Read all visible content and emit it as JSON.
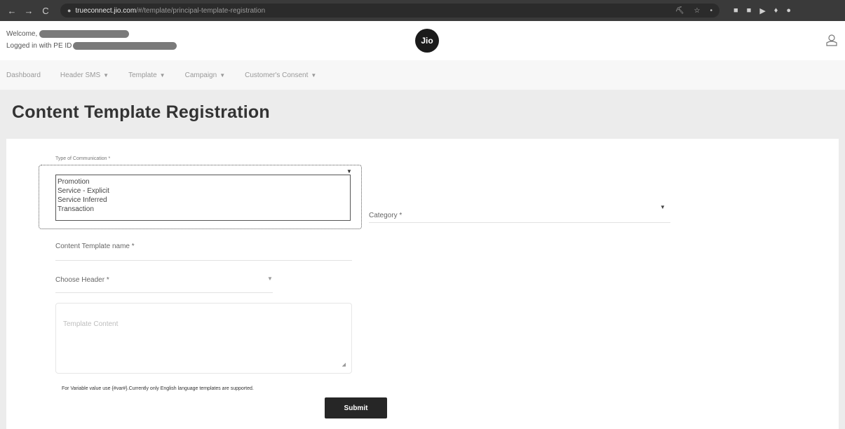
{
  "browser": {
    "nav": {
      "back": "←",
      "forward": "→",
      "reload": "C"
    },
    "url_host": "trueconnect.jio.com",
    "url_path": "/#/template/principal-template-registration"
  },
  "header": {
    "welcome_prefix": "Welcome,",
    "logged_in_prefix": "Logged in with PE ID",
    "logo_text": "Jio"
  },
  "menu": [
    {
      "label": "Dashboard",
      "caret": false
    },
    {
      "label": "Header SMS",
      "caret": true
    },
    {
      "label": "Template",
      "caret": true
    },
    {
      "label": "Campaign",
      "caret": true
    },
    {
      "label": "Customer's Consent",
      "caret": true
    }
  ],
  "page_title": "Content Template Registration",
  "form": {
    "type_label": "Type of Communication *",
    "type_options": [
      "Promotion",
      "Service - Explicit",
      "Service Inferred",
      "Transaction"
    ],
    "category_label": "Category *",
    "template_name_label": "Content Template name *",
    "choose_header_label": "Choose Header *",
    "content_placeholder": "Template Content",
    "note": "For Variable value use {#var#}.Currently only English language templates are supported.",
    "submit_label": "Submit"
  }
}
